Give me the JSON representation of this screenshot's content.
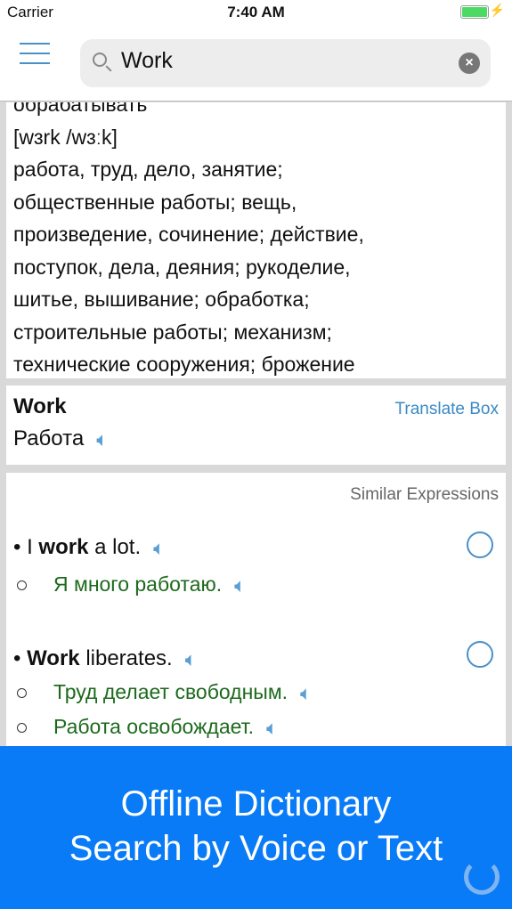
{
  "status": {
    "carrier": "Carrier",
    "time": "7:40 AM"
  },
  "search": {
    "value": "Work"
  },
  "definition": {
    "lines": [
      "обрабатывать",
      "[wɜrk /wɜːk]",
      "работа, труд, дело, занятие;",
      "общественные работы; вещь,",
      "произведение, сочинение; действие,",
      "поступок, дела, деяния; рукоделие,",
      "шитье, вышивание; обработка;",
      "строительные работы; механизм;",
      "технические сооружения; брожение"
    ]
  },
  "translate": {
    "word": "Work",
    "translation": "Работа",
    "link": "Translate Box"
  },
  "similar": {
    "header": "Similar Expressions",
    "examples": [
      {
        "pre": "I ",
        "bold": "work",
        "post": " a lot.",
        "ru": [
          "Я много работаю."
        ]
      },
      {
        "pre": "",
        "bold": "Work",
        "post": " liberates.",
        "ru": [
          "Труд делает свободным.",
          "Работа освобождает."
        ]
      }
    ]
  },
  "banner": {
    "line1": "Offline Dictionary",
    "line2": "Search by Voice or Text"
  },
  "icons": {
    "speaker": "speaker-icon",
    "menu": "hamburger-icon",
    "search": "search-icon",
    "clear": "clear-icon"
  },
  "colors": {
    "accent": "#0a7bf6",
    "link": "#3a8ac6",
    "russian": "#1d6a1d"
  }
}
